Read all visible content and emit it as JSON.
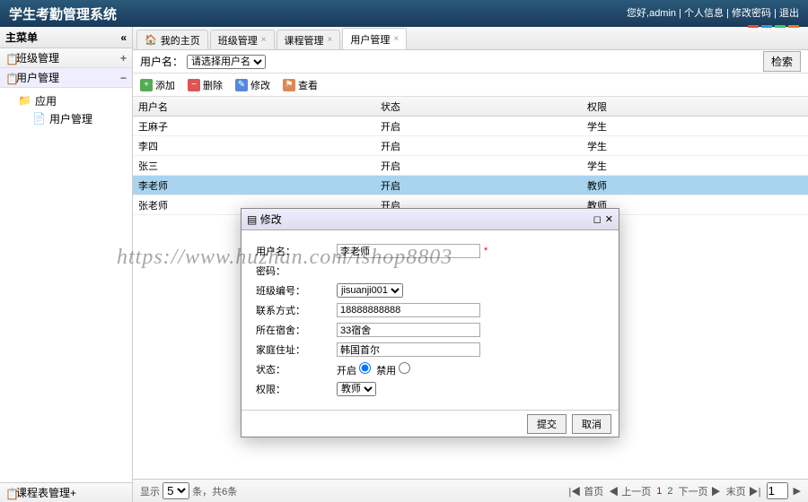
{
  "header": {
    "title": "学生考勤管理系统",
    "welcome": "您好,admin",
    "links": [
      "个人信息",
      "修改密码",
      "退出"
    ],
    "bar_colors": [
      "#e74c3c",
      "#3498db",
      "#2ecc71",
      "#e67e22"
    ]
  },
  "sidebar": {
    "title": "主菜单",
    "items": [
      {
        "label": "班级管理",
        "icon": "📋",
        "action": "+"
      },
      {
        "label": "用户管理",
        "icon": "📋",
        "action": "−"
      }
    ],
    "tree": {
      "folder": "应用",
      "leaf": "用户管理"
    },
    "bottom": {
      "label": "课程表管理",
      "icon": "📋",
      "action": "+"
    }
  },
  "tabs": [
    {
      "label": "我的主页",
      "icon": "🏠"
    },
    {
      "label": "班级管理"
    },
    {
      "label": "课程管理"
    },
    {
      "label": "用户管理"
    }
  ],
  "filter": {
    "label": "用户名：",
    "placeholder": "请选择用户名",
    "search": "检索"
  },
  "toolbar": {
    "add": "添加",
    "del": "删除",
    "edit": "修改",
    "view": "查看"
  },
  "grid": {
    "cols": [
      "用户名",
      "状态",
      "权限"
    ],
    "rows": [
      {
        "c": [
          "王麻子",
          "开启",
          "学生"
        ]
      },
      {
        "c": [
          "李四",
          "开启",
          "学生"
        ]
      },
      {
        "c": [
          "张三",
          "开启",
          "学生"
        ]
      },
      {
        "c": [
          "李老师",
          "开启",
          "教师"
        ],
        "sel": true
      },
      {
        "c": [
          "张老师",
          "开启",
          "教师"
        ]
      }
    ]
  },
  "pager": {
    "left_label": "显示",
    "per_page": "5",
    "left_suffix": "条，共6条",
    "first": "首页",
    "prev": "上一页",
    "pages": [
      "1",
      "2"
    ],
    "next": "下一页",
    "last": "末页",
    "goto": "1"
  },
  "dialog": {
    "title": "修改",
    "fields": {
      "username": {
        "label": "用户名：",
        "value": "李老师"
      },
      "password": {
        "label": "密码："
      },
      "class_no": {
        "label": "班级编号：",
        "value": "jisuanji001"
      },
      "contact": {
        "label": "联系方式：",
        "value": "18888888888"
      },
      "dorm": {
        "label": "所在宿舍：",
        "value": "33宿舍"
      },
      "address": {
        "label": "家庭住址：",
        "value": "韩国首尔"
      },
      "status": {
        "label": "状态：",
        "on": "开启",
        "off": "禁用"
      },
      "role": {
        "label": "权限：",
        "value": "教师"
      }
    },
    "submit": "提交",
    "cancel": "取消"
  },
  "watermark": "https://www.huzhan.com/ishop8803"
}
